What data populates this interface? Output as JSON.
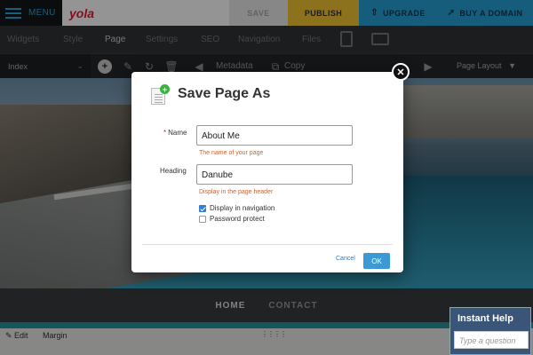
{
  "topbar": {
    "menu_label": "MENU",
    "logo": "yola",
    "save": "SAVE",
    "publish": "PUBLISH",
    "upgrade": "UPGRADE",
    "buy_domain": "BUY A DOMAIN"
  },
  "nav_tabs": [
    "Widgets",
    "Style",
    "Page",
    "Settings",
    "SEO",
    "Navigation",
    "Files"
  ],
  "active_tab": "Page",
  "toolbar": {
    "page_select": "Index",
    "metadata": "Metadata",
    "copy": "Copy",
    "page_layout": "Page Layout"
  },
  "site_nav": [
    "HOME",
    "CONTACT"
  ],
  "editbar": {
    "edit": "Edit",
    "margin": "Margin"
  },
  "help": {
    "title": "Instant Help",
    "placeholder": "Type a question"
  },
  "dialog": {
    "title": "Save Page As",
    "name_label": "Name",
    "name_value": "About Me",
    "name_hint": "The name of your page",
    "heading_label": "Heading",
    "heading_value": "Danube",
    "heading_hint": "Display in the page header",
    "display_nav_label": "Display in navigation",
    "display_nav_checked": true,
    "password_label": "Password protect",
    "password_checked": false,
    "cancel": "Cancel",
    "ok": "OK"
  },
  "colors": {
    "brand_red": "#e2173b",
    "publish_yellow": "#f2c531",
    "upgrade_blue": "#27a0d6",
    "ok_blue": "#3b9ad6",
    "hint_orange": "#d0622d"
  }
}
